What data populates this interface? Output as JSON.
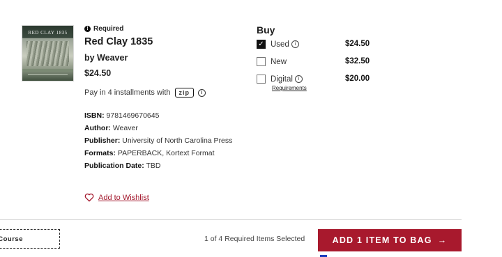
{
  "product": {
    "cover_title": "RED CLAY 1835",
    "required_label": "Required",
    "title": "Red Clay 1835",
    "author_line": "by Weaver",
    "price": "$24.50",
    "installments_text": "Pay in 4 installments with",
    "zip_label": "zip",
    "isbn_label": "ISBN:",
    "isbn": "9781469670645",
    "author_label": "Author:",
    "author": "Weaver",
    "publisher_label": "Publisher:",
    "publisher": "University of North Carolina Press",
    "formats_label": "Formats:",
    "formats": "PAPERBACK, Kortext Format",
    "pubdate_label": "Publication Date:",
    "pubdate": "TBD",
    "wishlist_label": "Add to Wishlist"
  },
  "buy": {
    "heading": "Buy",
    "options": [
      {
        "label": "Used",
        "price": "$24.50",
        "checked": true
      },
      {
        "label": "New",
        "price": "$32.50",
        "checked": false
      },
      {
        "label": "Digital",
        "price": "$20.00",
        "checked": false
      }
    ],
    "requirements_label": "Requirements"
  },
  "footer": {
    "course_label": "Course",
    "selected_count": "1 of 4 Required Items Selected",
    "add_button_label": "ADD 1 ITEM TO BAG",
    "add_button_arrow": "→"
  },
  "colors": {
    "accent": "#a8192d",
    "wishlist": "#a3172c"
  }
}
